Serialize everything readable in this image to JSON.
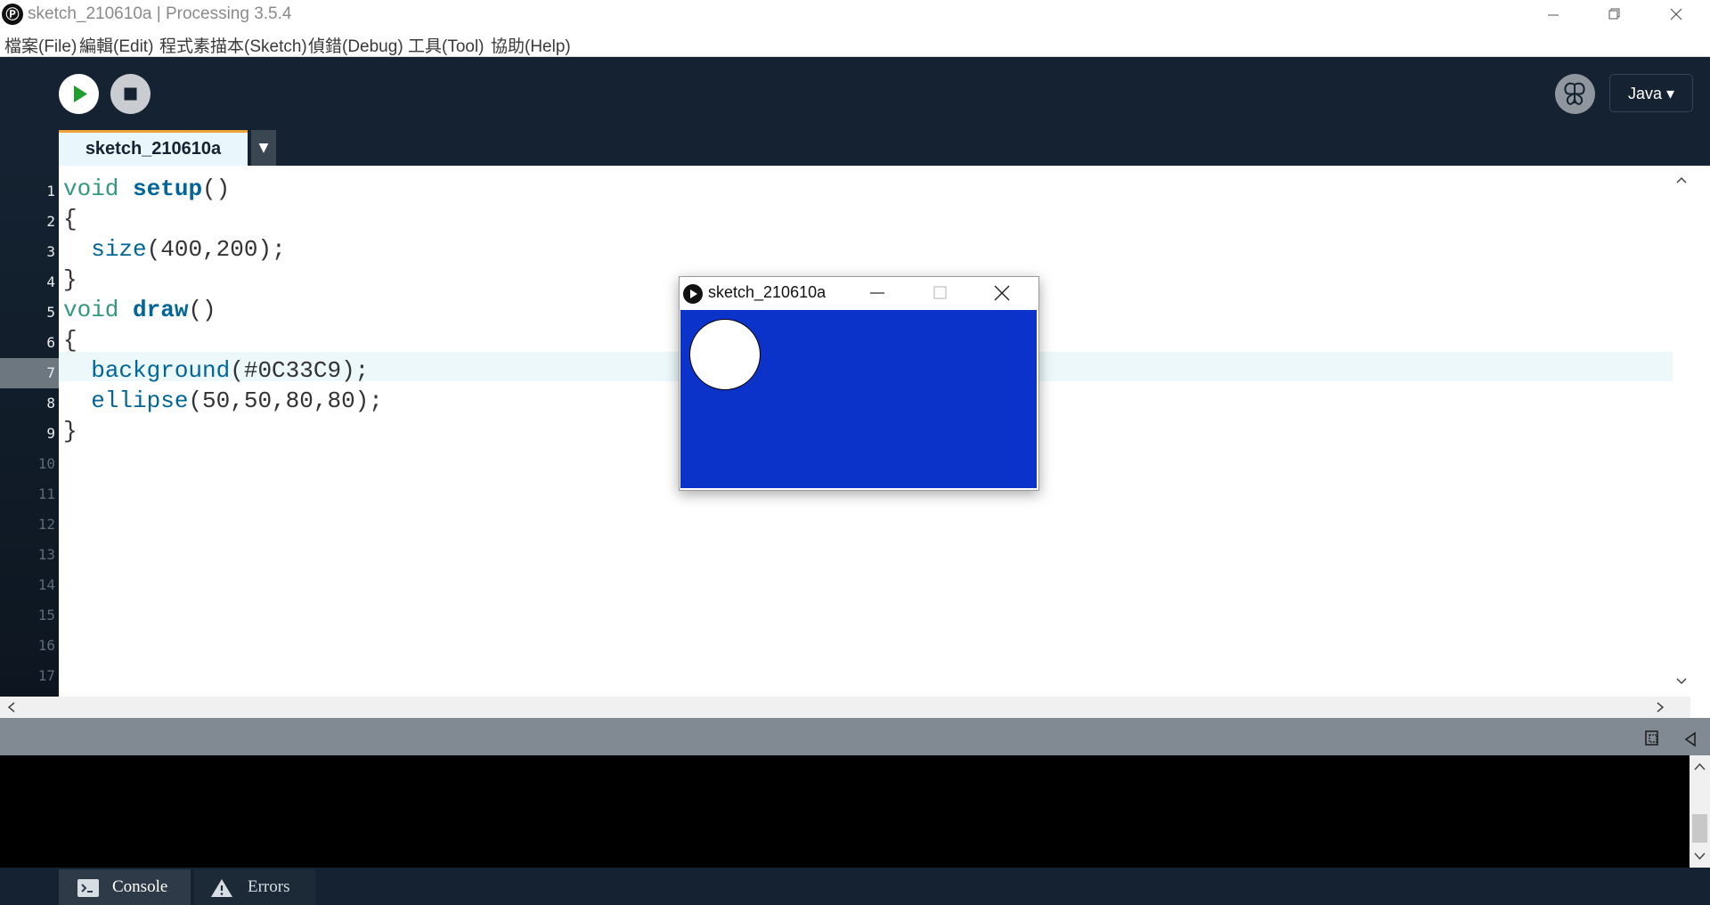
{
  "window": {
    "title": "sketch_210610a | Processing 3.5.4",
    "app_icon": "Ⓟ"
  },
  "menu": [
    "檔案(File)",
    "編輯(Edit)",
    "程式素描本(Sketch)",
    "偵錯(Debug)",
    "工具(Tool)",
    "協助(Help)"
  ],
  "toolbar": {
    "mode_label": "Java ▾"
  },
  "tab": {
    "name": "sketch_210610a",
    "menu_arrow": "▼"
  },
  "editor": {
    "line_numbers": [
      "1",
      "2",
      "3",
      "4",
      "5",
      "6",
      "7",
      "8",
      "9",
      "10",
      "11",
      "12",
      "13",
      "14",
      "15",
      "16",
      "17"
    ],
    "current_line": 7,
    "lines": [
      {
        "kw": "void",
        "fn": "setup",
        "rest": "()"
      },
      {
        "text": "{"
      },
      {
        "indent": "  ",
        "fn": "size",
        "rest": "(400,200);"
      },
      {
        "text": "}"
      },
      {
        "kw": "void",
        "fn": "draw",
        "rest": "()"
      },
      {
        "text": "{"
      },
      {
        "indent": "  ",
        "fn": "background",
        "rest": "(#0C33C9);"
      },
      {
        "indent": "  ",
        "fn": "ellipse",
        "rest": "(50,50,80,80);"
      },
      {
        "text": "}"
      }
    ]
  },
  "sketch_window": {
    "title": "sketch_210610a",
    "canvas_color": "#0c33c9",
    "ellipse_fill": "#ffffff"
  },
  "console_tabs": {
    "console": "Console",
    "errors": "Errors"
  },
  "colors": {
    "toolbar_bg": "#142231",
    "tab_accent": "#f0a23b",
    "run_icon": "#1d9e2f"
  }
}
